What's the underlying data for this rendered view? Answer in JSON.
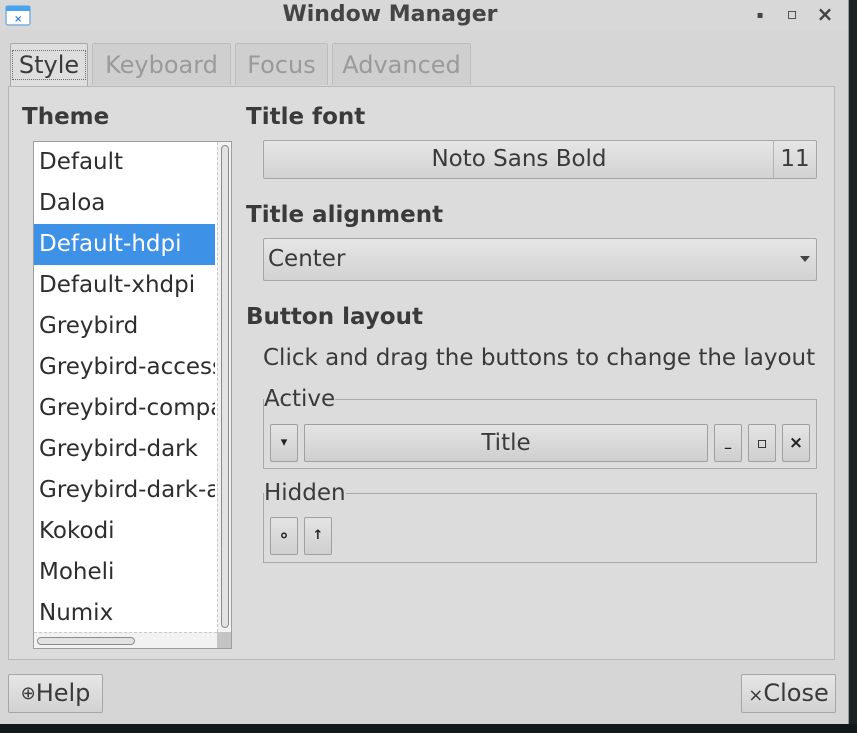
{
  "window": {
    "title": "Window Manager",
    "controls": {
      "minimize": "▪",
      "maximize": "▫",
      "close": "×"
    }
  },
  "tabs": [
    {
      "label": "Style",
      "active": true
    },
    {
      "label": "Keyboard",
      "active": false
    },
    {
      "label": "Focus",
      "active": false
    },
    {
      "label": "Advanced",
      "active": false
    }
  ],
  "theme": {
    "label": "Theme",
    "items": [
      "Default",
      "Daloa",
      "Default-hdpi",
      "Default-xhdpi",
      "Greybird",
      "Greybird-accessibility",
      "Greybird-compact",
      "Greybird-dark",
      "Greybird-dark-accessibility",
      "Kokodi",
      "Moheli",
      "Numix"
    ],
    "selected": "Default-hdpi"
  },
  "title_font": {
    "label": "Title font",
    "font_name": "Noto Sans Bold",
    "font_size": "11"
  },
  "title_alignment": {
    "label": "Title alignment",
    "value": "Center"
  },
  "button_layout": {
    "label": "Button layout",
    "hint": "Click and drag the buttons to change the layout",
    "active_label": "Active",
    "active_buttons": {
      "menu": "▾",
      "title": "Title",
      "minimize": "_",
      "maximize": "▫",
      "close": "×"
    },
    "hidden_label": "Hidden",
    "hidden_buttons": {
      "stick": "∘",
      "shade": "↑"
    }
  },
  "footer": {
    "help_label": "Help",
    "close_label": "Close"
  },
  "colors": {
    "selection": "#3d91e6",
    "window_bg": "#d6d6d6"
  }
}
